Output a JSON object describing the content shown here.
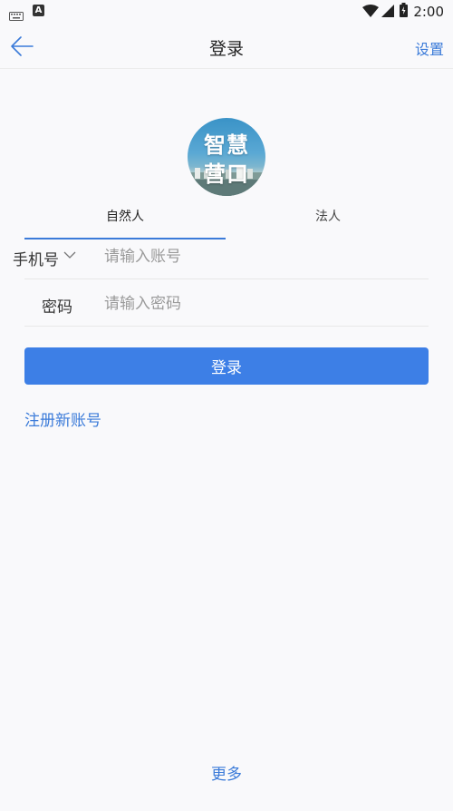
{
  "status_bar": {
    "time": "2:00",
    "icons": [
      "keyboard-icon",
      "a-notification-icon",
      "wifi-icon",
      "signal-icon",
      "battery-icon"
    ],
    "a_icon_text": "A"
  },
  "header": {
    "title": "登录",
    "settings_label": "设置",
    "back_icon": "arrow-left-icon"
  },
  "logo": {
    "line1": "智慧",
    "line2": "营口"
  },
  "tabs": [
    {
      "label": "自然人",
      "active": true
    },
    {
      "label": "法人",
      "active": false
    }
  ],
  "form": {
    "account_type_label": "手机号",
    "account_placeholder": "请输入账号",
    "account_value": "",
    "password_label": "密码",
    "password_placeholder": "请输入密码",
    "password_value": ""
  },
  "login_button_label": "登录",
  "register_link": "注册新账号",
  "more_link": "更多",
  "colors": {
    "accent": "#3b7bd9",
    "button": "#3d7fe6",
    "background": "#f9f9fb"
  }
}
